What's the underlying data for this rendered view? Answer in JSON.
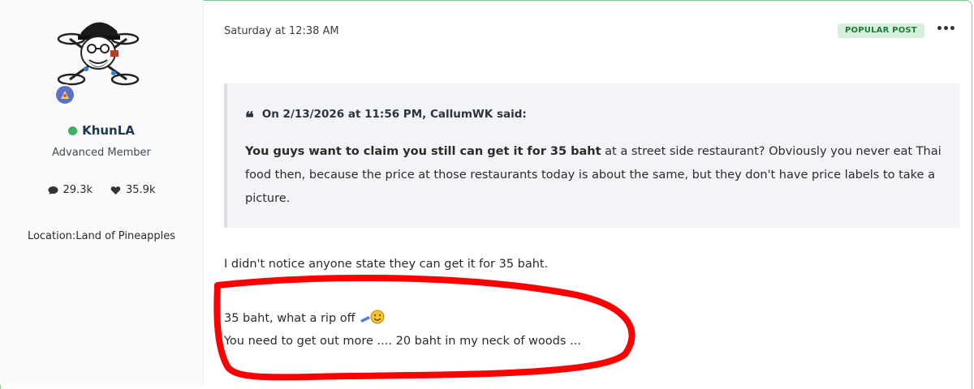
{
  "post": {
    "date": "Saturday at 12:38 AM",
    "badge": "POPULAR POST",
    "menu": "•••"
  },
  "author": {
    "name": "KhunLA",
    "rank": "Advanced Member",
    "posts": "29.3k",
    "likes": "35.9k",
    "location": "Location:Land of Pineapples",
    "online_color": "#3db161"
  },
  "quote": {
    "citation": "On 2/13/2026 at 11:56 PM, CallumWK said:",
    "bold_text": "You guys want to claim you still can get it for 35 baht",
    "text": " at a street side restaurant? Obviously you never eat Thai food then, because the price at those restaurants today is about the same, but they don't have price labels to take a picture."
  },
  "body": {
    "line1": "I didn't notice anyone state they can get it for 35 baht.",
    "line2": "35 baht, what a rip off",
    "line3": "You need to get out more .... 20 baht in my neck of woods ..."
  },
  "colors": {
    "accent_green": "#3db161",
    "annotation_red": "#ff0000"
  }
}
